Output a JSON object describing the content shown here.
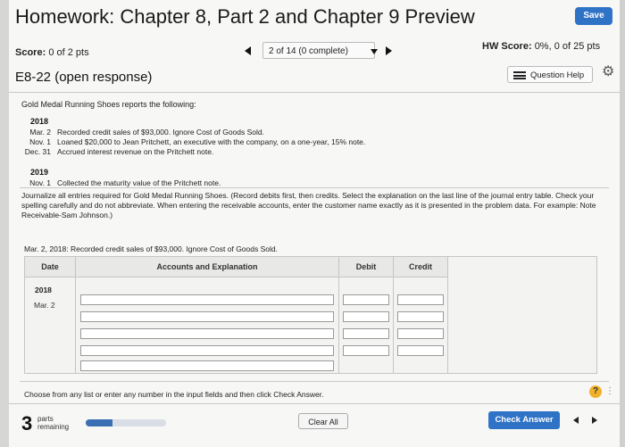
{
  "header": {
    "title": "Homework: Chapter 8, Part 2 and Chapter 9 Preview",
    "save_label": "Save"
  },
  "status": {
    "score_label": "Score:",
    "score_value": "0 of 2 pts",
    "position": "2 of 14 (0 complete)",
    "hw_label": "HW Score:",
    "hw_value": "0%, 0 of 25 pts"
  },
  "exercise": {
    "title": "E8-22 (open response)",
    "help_label": "Question Help"
  },
  "problem": {
    "intro": "Gold Medal Running Shoes reports the following:",
    "years": [
      {
        "year": "2018",
        "items": [
          {
            "date": "Mar. 2",
            "text": "Recorded credit sales of $93,000. Ignore Cost of Goods Sold."
          },
          {
            "date": "Nov. 1",
            "text": "Loaned $20,000 to Jean Pritchett, an executive with the company, on a one-year, 15% note."
          },
          {
            "date": "Dec. 31",
            "text": "Accrued interest revenue on the Pritchett note."
          }
        ]
      },
      {
        "year": "2019",
        "items": [
          {
            "date": "Nov. 1",
            "text": "Collected the maturity value of the Pritchett note."
          }
        ]
      }
    ],
    "instructions": "Journalize all entries required for Gold Medal Running Shoes. (Record debits first, then credits. Select the explanation on the last line of the journal entry table. Check your spelling carefully and do not abbreviate. When entering the receivable accounts, enter the customer name exactly as it is presented in the problem data. For example: Note Receivable-Sam Johnson.)"
  },
  "journal": {
    "prompt": "Mar. 2, 2018: Recorded credit sales of $93,000. Ignore Cost of Goods Sold.",
    "columns": {
      "date": "Date",
      "account": "Accounts and Explanation",
      "debit": "Debit",
      "credit": "Credit"
    },
    "year": "2018",
    "date": "Mar. 2"
  },
  "footer": {
    "hint": "Choose from any list or enter any number in the input fields and then click Check Answer.",
    "help_symbol": "?",
    "parts_count": "3",
    "parts_label_1": "parts",
    "parts_label_2": "remaining",
    "parts_progress": 0.33,
    "clear_label": "Clear All",
    "check_label": "Check Answer"
  },
  "colors": {
    "primary_button": "#2f73c7",
    "help_badge": "#f2b12c",
    "progress_fill": "#3b6fb4"
  }
}
